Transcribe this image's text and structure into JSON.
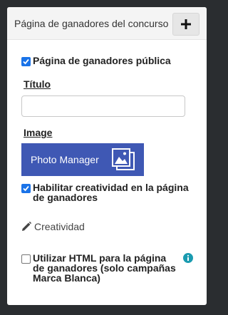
{
  "header": {
    "title": "Página de ganadores del concurso",
    "add_button": "+"
  },
  "public_page": {
    "label": "Página de ganadores pública",
    "checked": true
  },
  "title_field": {
    "label": "Título",
    "value": "",
    "placeholder": ""
  },
  "image_field": {
    "label": "Image",
    "button_label": "Photo Manager"
  },
  "enable_creative": {
    "label": "Habilitar creatividad en la página de ganadores",
    "checked": true
  },
  "creatividad_link": {
    "label": "Creatividad"
  },
  "use_html": {
    "label": "Utilizar HTML para la página de ganadores (solo campañas Marca Blanca)",
    "checked": false
  },
  "icons": {
    "add": "plus-icon",
    "photo": "photo-gallery-icon",
    "edit": "pencil-icon",
    "info": "info-icon"
  },
  "colors": {
    "accent": "#3f58b4",
    "checkbox": "#1a73e8",
    "info": "#1a9bb0",
    "background": "#2a2d30"
  }
}
